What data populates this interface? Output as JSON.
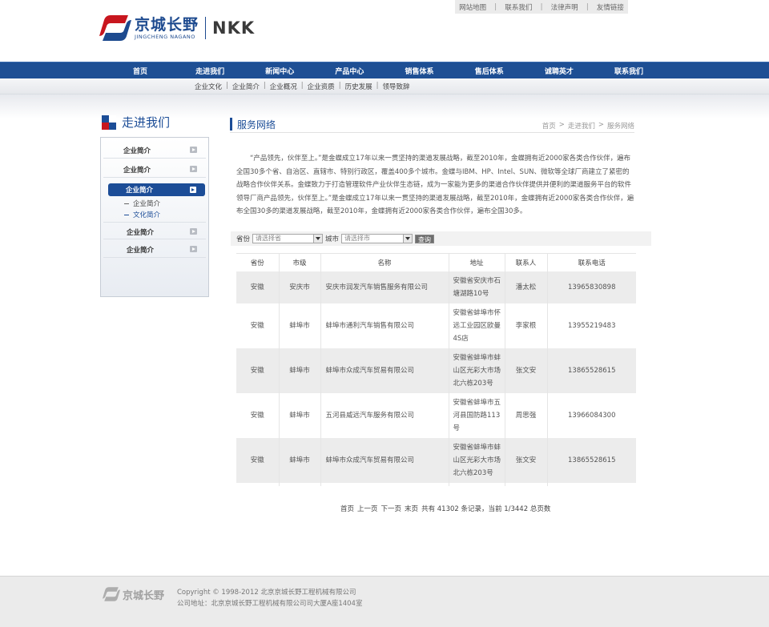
{
  "top_links": [
    "网站地图",
    "联系我们",
    "法律声明",
    "友情链接"
  ],
  "logo": {
    "cn": "京城长野",
    "en": "JINGCHENG NAGANO",
    "brand": "NKK"
  },
  "main_nav": [
    "首页",
    "走进我们",
    "新闻中心",
    "产品中心",
    "销售体系",
    "售后体系",
    "诚聘英才",
    "联系我们"
  ],
  "sub_nav": [
    "企业文化",
    "企业简介",
    "企业概况",
    "企业资质",
    "历史发展",
    "领导致辞"
  ],
  "sidebar": {
    "title": "走进我们",
    "items": [
      "企业简介",
      "企业简介",
      "企业简介",
      "企业简介",
      "企业简介"
    ],
    "sub_items": [
      "企业简介",
      "文化简介"
    ]
  },
  "content": {
    "title": "服务网络",
    "breadcrumb": [
      "首页",
      ">",
      "走进我们",
      ">",
      "服务网络"
    ],
    "intro": "“产品领先，伙伴至上。”是金蝶成立17年以来一贯坚持的渠道发展战略，截至2010年，金蝶拥有近2000家各类合作伙伴，遍布全国30多个省、自治区、直辖市、特别行政区，覆盖400多个城市。金蝶与IBM、HP、Intel、SUN、微软等全球厂商建立了紧密的战略合作伙伴关系。金蝶致力于打造管理软件产业伙伴生态链，成为一家能为更多的渠道合作伙伴提供并便利的渠道服务平台的软件领导厂商产品领先，伙伴至上。”是金蝶成立17年以来一贯坚持的渠道发展战略，截至2010年，金蝶拥有近2000家各类合作伙伴，遍布全国30多的渠道发展战略，截至2010年，金蝶拥有近2000家各类合作伙伴，遍布全国30多。"
  },
  "filter": {
    "province_label": "省份",
    "province_placeholder": "请选择省",
    "city_label": "城市",
    "city_placeholder": "请选择市",
    "button": "查询"
  },
  "table": {
    "headers": [
      "省份",
      "市级",
      "名称",
      "地址",
      "联系人",
      "联系电话"
    ],
    "rows": [
      [
        "安徽",
        "安庆市",
        "安庆市润发汽车销售服务有限公司",
        "安徽省安庆市石\n塘湖路10号",
        "潘太松",
        "13965830898"
      ],
      [
        "安徽",
        "蚌埠市",
        "蚌埠市通利汽车销售有限公司",
        "安徽省蚌埠市怀\n远工业园区欧曼\n4S店",
        "李家根",
        "13955219483"
      ],
      [
        "安徽",
        "蚌埠市",
        "蚌埠市众成汽车贸易有限公司",
        "安徽省蚌埠市蚌\n山区光彩大市场\n北六栋203号",
        "张文安",
        "13865528615"
      ],
      [
        "安徽",
        "蚌埠市",
        "五河县威远汽车服务有限公司",
        "安徽省蚌埠市五\n河县国防路113\n号",
        "周思强",
        "13966084300"
      ],
      [
        "安徽",
        "蚌埠市",
        "蚌埠市众成汽车贸易有限公司",
        "安徽省蚌埠市蚌\n山区光彩大市场\n北六栋203号",
        "张文安",
        "13865528615"
      ]
    ]
  },
  "pager": {
    "first": "首页",
    "prev": "上一页",
    "next": "下一页",
    "last": "末页",
    "summary": "共有 41302 条记录，当前 1/3442 总页数"
  },
  "footer": {
    "logo_cn": "京城长野",
    "copyright": "Copyright © 1998-2012 北京京城长野工程机械有限公司",
    "address": "公司地址：北京京城长野工程机械有限公司司大厦A座1404室"
  },
  "colors": {
    "primary": "#1e4f94",
    "accent_red": "#c8161e",
    "stripe": "#ececec"
  }
}
